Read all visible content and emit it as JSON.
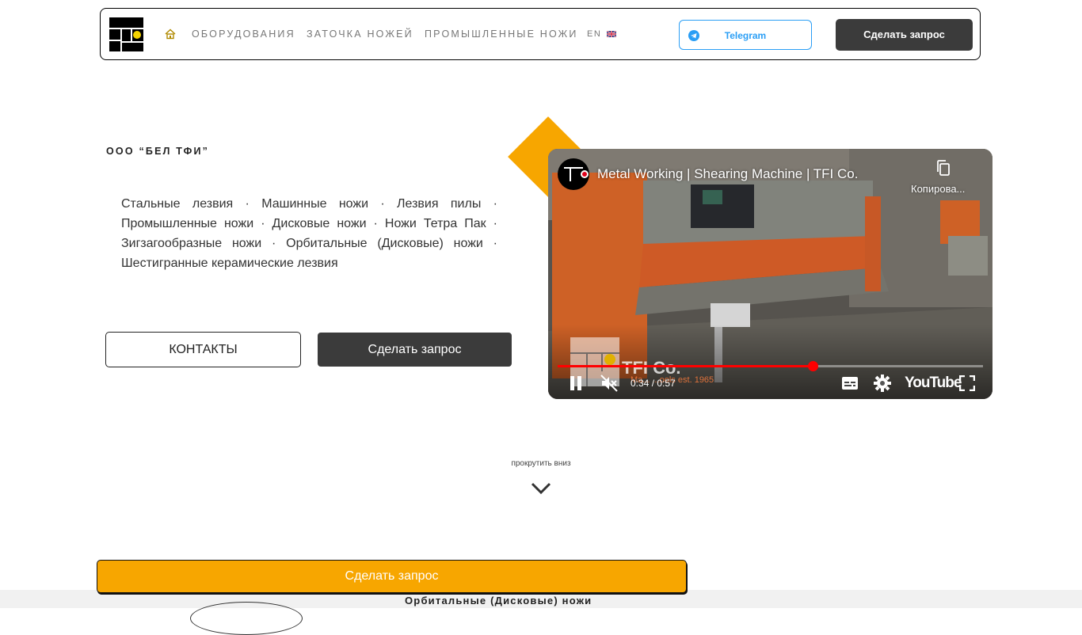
{
  "header": {
    "logo_icon": "company-logo",
    "home_icon": "home-icon",
    "nav": [
      "ОБОРУДОВАНИЯ",
      "ЗАТОЧКА НОЖЕЙ",
      "ПРОМЫШЛЕННЫЕ НОЖИ"
    ],
    "lang": "EN",
    "lang_flag": "uk-flag-icon",
    "telegram_label": "Telegram",
    "request_label": "Сделать запрос",
    "accent_color": "#2a9ef5"
  },
  "hero": {
    "company": "ООО “БЕЛ ТФИ”",
    "description": "Стальные лезвия · Машинные ножи · Лезвия пилы · Промышленные ножи · Дисковые ножи · Ножи Тетра Пак · Зигзагообразные ножи · Орбитальные (Дисковые) ножи · Шестигранные керамические лезвия",
    "contacts_label": "КОНТАКТЫ",
    "request_label": "Сделать запрос",
    "accent_color": "#f7a600"
  },
  "video": {
    "title": "Metal Working | Shearing Machine | TFI Co.",
    "copy_label": "Копирова...",
    "watermark_brand": "TFI Co.",
    "watermark_sub": "Ma... ...ools est. 1965",
    "time": "0:34 / 0:57",
    "progress": 0.6,
    "platform": "YouTube",
    "state": "playing",
    "muted": true
  },
  "scroll": {
    "label": "прокрутить вниз",
    "icon": "chevron-down-icon"
  },
  "bottom": {
    "section_title": "Орбитальные (Дисковые) ножи",
    "sticky_request_label": "Сделать запрос"
  }
}
